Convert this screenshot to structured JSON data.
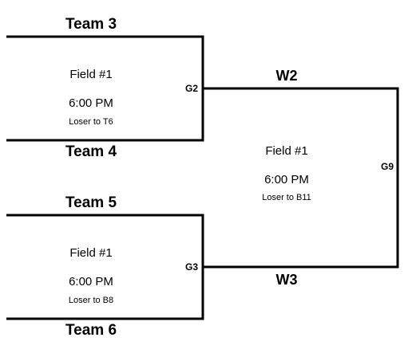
{
  "games": [
    {
      "id": "G2",
      "top_team": "Team 3",
      "bottom_team": "Team 4",
      "field": "Field #1",
      "time": "6:00 PM",
      "loser_note": "Loser to T6"
    },
    {
      "id": "G3",
      "top_team": "Team 5",
      "bottom_team": "Team 6",
      "field": "Field #1",
      "time": "6:00 PM",
      "loser_note": "Loser to B8"
    },
    {
      "id": "G9",
      "top_team": "W2",
      "bottom_team": "W3",
      "field": "Field #1",
      "time": "6:00 PM",
      "loser_note": "Loser to B11"
    }
  ],
  "colors": {
    "line": "#000000",
    "background": "#ffffff"
  }
}
